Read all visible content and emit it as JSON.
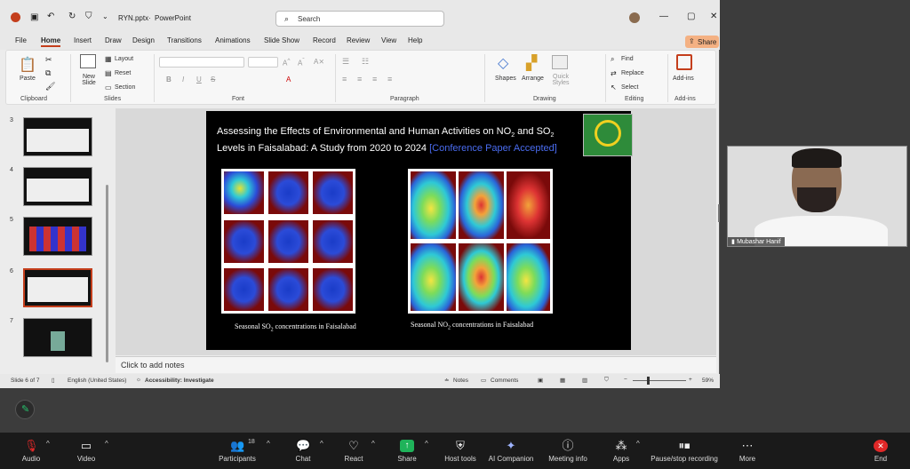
{
  "titlebar": {
    "file_name": "RYN.pptx",
    "separator": "·",
    "app_name": "PowerPoint",
    "search_placeholder": "Search"
  },
  "tabs": [
    "File",
    "Home",
    "Insert",
    "Draw",
    "Design",
    "Transitions",
    "Animations",
    "Slide Show",
    "Record",
    "Review",
    "View",
    "Help"
  ],
  "share_label": "Share",
  "ribbon": {
    "paste": "Paste",
    "clipboard": "Clipboard",
    "new_slide": "New Slide",
    "layout": "Layout",
    "reset": "Reset",
    "section": "Section",
    "slides": "Slides",
    "font": "Font",
    "paragraph": "Paragraph",
    "shapes": "Shapes",
    "arrange": "Arrange",
    "quick_styles": "Quick Styles",
    "drawing": "Drawing",
    "find": "Find",
    "replace": "Replace",
    "select": "Select",
    "editing": "Editing",
    "addins": "Add-ins",
    "addins_group": "Add-ins"
  },
  "thumbnails": [
    "3",
    "4",
    "5",
    "6",
    "7"
  ],
  "slide": {
    "title_line1": "Assessing the Effects of Environmental and Human Activities on NO",
    "sub2a": "2",
    "and": " and",
    "so": "SO",
    "sub2b": "2",
    "title_line2": " Levels in Faisalabad: A Study from 2020 to 2024 ",
    "accepted": "[Conference Paper Accepted]",
    "left_caption": "Seasonal SO",
    "left_caption_sub": "2",
    "left_caption_end": " concentrations in Faisalabad",
    "right_caption": "Seasonal NO",
    "right_caption_sub": "2",
    "right_caption_end": " concentrations in Faisalabad"
  },
  "notes_placeholder": "Click to add notes",
  "status": {
    "slide_of": "Slide 6 of 7",
    "language": "English (United States)",
    "accessibility": "Accessibility: Investigate",
    "notes": "Notes",
    "comments": "Comments",
    "zoom": "59%"
  },
  "participant_name": "Mubashar Hanif",
  "zoom_toolbar": {
    "audio": "Audio",
    "video": "Video",
    "participants": "Participants",
    "participants_count": "18",
    "chat": "Chat",
    "react": "React",
    "share": "Share",
    "host_tools": "Host tools",
    "ai_companion": "AI Companion",
    "meeting_info": "Meeting info",
    "apps": "Apps",
    "pause_stop": "Pause/stop recording",
    "more": "More",
    "end": "End"
  },
  "colors": {
    "accent": "#c43e1c",
    "share_green": "#1fb35a",
    "end_red": "#e02828",
    "zoom_bg": "#1a1a1a"
  }
}
